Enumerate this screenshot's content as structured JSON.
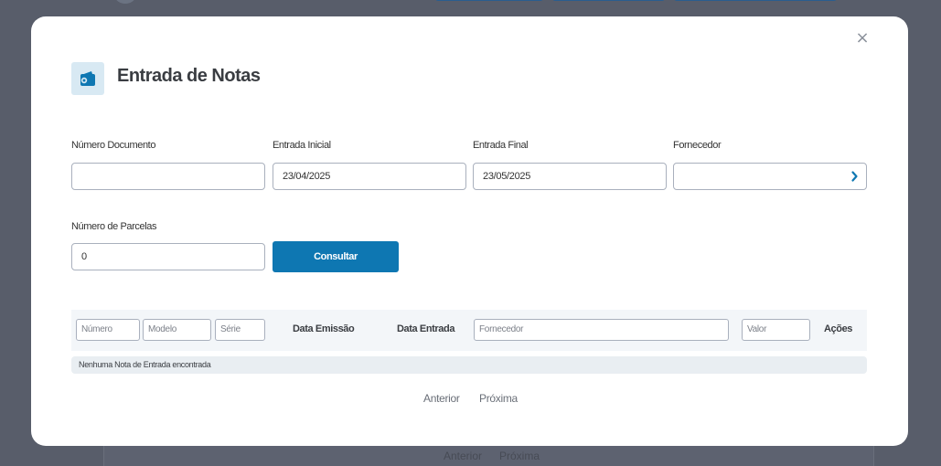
{
  "modal": {
    "title": "Entrada de Notas",
    "close_label": "×"
  },
  "form": {
    "numero_documento": {
      "label": "Número Documento",
      "value": ""
    },
    "entrada_inicial": {
      "label": "Entrada Inicial",
      "value": "23/04/2025"
    },
    "entrada_final": {
      "label": "Entrada Final",
      "value": "23/05/2025"
    },
    "fornecedor": {
      "label": "Fornecedor",
      "value": ""
    },
    "numero_parcelas": {
      "label": "Número de Parcelas",
      "value": "0"
    },
    "consultar_label": "Consultar"
  },
  "table": {
    "filters": {
      "numero": "Número",
      "modelo": "Modelo",
      "serie": "Série",
      "fornecedor": "Fornecedor",
      "valor": "Valor"
    },
    "headers": {
      "data_emissao": "Data Emissão",
      "data_entrada": "Data Entrada",
      "acoes": "Ações"
    },
    "empty_message": "Nenhuma Nota de Entrada encontrada"
  },
  "pagination": {
    "previous": "Anterior",
    "next": "Próxima"
  },
  "colors": {
    "primary": "#0e77b2",
    "overlay": "#585d6a",
    "icon_bg": "#d8e9f3"
  }
}
